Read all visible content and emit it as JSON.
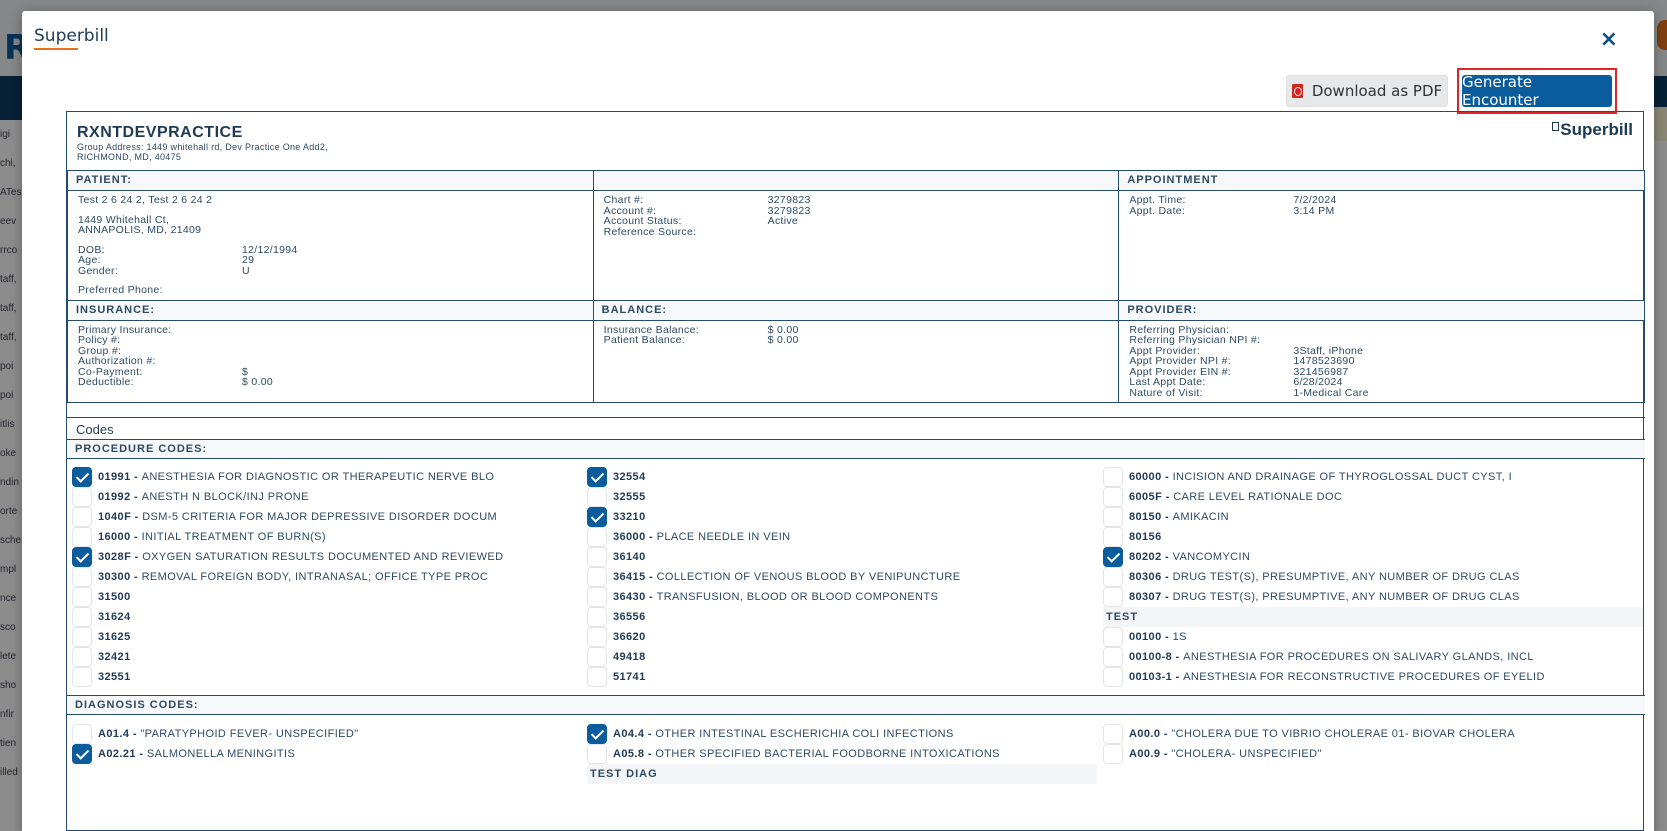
{
  "background": {
    "logo": "R",
    "sidebar_fragments": [
      "igi",
      "chi,",
      "ATes",
      "eev",
      "rrco",
      "taff,",
      "taff,",
      "taff,",
      "poi",
      "poi",
      "itlis",
      "oke",
      "ndin",
      "orte",
      "sche",
      "mpl",
      "nce",
      "sco",
      "lete",
      "sho",
      "nfir",
      "tien",
      "illed"
    ]
  },
  "modal": {
    "title": "Superbill",
    "close_icon": "×",
    "download_pdf_label": "Download as PDF",
    "generate_encounter_label": "Generate Encounter"
  },
  "sheet": {
    "practice_name": "RXNTDEVPRACTICE",
    "address_line1": "Group Address: 1449 whitehall rd, Dev Practice One Add2,",
    "address_line2": "RICHMOND, MD, 40475",
    "title": "Superbill"
  },
  "patient": {
    "header": "PATIENT:",
    "name": "Test 2 6 24 2, Test 2 6 24 2",
    "street": "1449 Whitehall Ct,",
    "city": "ANNAPOLIS, MD, 21409",
    "dob_label": "DOB:",
    "dob": "12/12/1994",
    "age_label": "Age:",
    "age": "29",
    "gender_label": "Gender:",
    "gender": "U",
    "phone_label": "Preferred Phone:"
  },
  "chart": {
    "chart_label": "Chart #:",
    "chart": "3279823",
    "account_label": "Account #:",
    "account": "3279823",
    "status_label": "Account Status:",
    "status": "Active",
    "ref_label": "Reference Source:"
  },
  "appointment": {
    "header": "APPOINTMENT",
    "time_label": "Appt. Time:",
    "time": "7/2/2024",
    "date_label": "Appt. Date:",
    "date": "3:14 PM"
  },
  "insurance": {
    "header": "INSURANCE:",
    "primary_label": "Primary Insurance:",
    "policy_label": "Policy #:",
    "group_label": "Group #:",
    "auth_label": "Authorization #:",
    "copay_label": "Co-Payment:",
    "copay": "$",
    "deductible_label": "Deductible:",
    "deductible": "$ 0.00"
  },
  "balance": {
    "header": "BALANCE:",
    "ins_label": "Insurance Balance:",
    "ins": "$ 0.00",
    "pat_label": "Patient Balance:",
    "pat": "$ 0.00"
  },
  "provider": {
    "header": "PROVIDER:",
    "ref_label": "Referring Physician:",
    "ref_npi_label": "Referring Physician NPI #:",
    "appt_prov_label": "Appt Provider:",
    "appt_prov": "3Staff, iPhone",
    "npi_label": "Appt Provider NPI #:",
    "npi": "1478523690",
    "ein_label": "Appt Provider EIN #:",
    "ein": "321456987",
    "last_label": "Last Appt Date:",
    "last": "6/28/2024",
    "nature_label": "Nature of Visit:",
    "nature": "1-Medical Care"
  },
  "codes": {
    "label": "Codes",
    "procedure_header": "PROCEDURE CODES:",
    "diagnosis_header": "DIAGNOSIS CODES:",
    "proc_col1": [
      {
        "code": "01991",
        "desc": "ANESTHESIA FOR DIAGNOSTIC OR THERAPEUTIC NERVE BLO",
        "checked": true
      },
      {
        "code": "01992",
        "desc": "ANESTH N BLOCK/INJ PRONE",
        "checked": false
      },
      {
        "code": "1040F",
        "desc": "DSM-5 CRITERIA FOR MAJOR DEPRESSIVE DISORDER DOCUM",
        "checked": false
      },
      {
        "code": "16000",
        "desc": "INITIAL TREATMENT OF BURN(S)",
        "checked": false
      },
      {
        "code": "3028F",
        "desc": "OXYGEN SATURATION RESULTS DOCUMENTED AND REVIEWED",
        "checked": true
      },
      {
        "code": "30300",
        "desc": "REMOVAL FOREIGN BODY, INTRANASAL; OFFICE TYPE PROC",
        "checked": false
      },
      {
        "code": "31500",
        "desc": "",
        "checked": false
      },
      {
        "code": "31624",
        "desc": "",
        "checked": false
      },
      {
        "code": "31625",
        "desc": "",
        "checked": false
      },
      {
        "code": "32421",
        "desc": "",
        "checked": false
      },
      {
        "code": "32551",
        "desc": "",
        "checked": false
      }
    ],
    "proc_col2": [
      {
        "code": "32554",
        "desc": "",
        "checked": true
      },
      {
        "code": "32555",
        "desc": "",
        "checked": false
      },
      {
        "code": "33210",
        "desc": "",
        "checked": true
      },
      {
        "code": "36000",
        "desc": "PLACE NEEDLE IN VEIN",
        "checked": false
      },
      {
        "code": "36140",
        "desc": "",
        "checked": false
      },
      {
        "code": "36415",
        "desc": "COLLECTION OF VENOUS BLOOD BY VENIPUNCTURE",
        "checked": false
      },
      {
        "code": "36430",
        "desc": "TRANSFUSION, BLOOD OR BLOOD COMPONENTS",
        "checked": false
      },
      {
        "code": "36556",
        "desc": "",
        "checked": false
      },
      {
        "code": "36620",
        "desc": "",
        "checked": false
      },
      {
        "code": "49418",
        "desc": "",
        "checked": false
      },
      {
        "code": "51741",
        "desc": "",
        "checked": false
      }
    ],
    "proc_col3_a": [
      {
        "code": "60000",
        "desc": "INCISION AND DRAINAGE OF THYROGLOSSAL DUCT CYST, I",
        "checked": false
      },
      {
        "code": "6005F",
        "desc": "CARE LEVEL RATIONALE DOC",
        "checked": false
      },
      {
        "code": "80150",
        "desc": "AMIKACIN",
        "checked": false
      },
      {
        "code": "80156",
        "desc": "",
        "checked": false
      },
      {
        "code": "80202",
        "desc": "VANCOMYCIN",
        "checked": true
      },
      {
        "code": "80306",
        "desc": "DRUG TEST(S), PRESUMPTIVE, ANY NUMBER OF DRUG CLAS",
        "checked": false
      },
      {
        "code": "80307",
        "desc": "DRUG TEST(S), PRESUMPTIVE, ANY NUMBER OF DRUG CLAS",
        "checked": false
      }
    ],
    "proc_group_label": "TEST",
    "proc_col3_b": [
      {
        "code": "00100",
        "desc": "1S",
        "checked": false
      },
      {
        "code": "00100-8",
        "desc": "ANESTHESIA FOR PROCEDURES ON SALIVARY GLANDS, INCL",
        "checked": false
      },
      {
        "code": "00103-1",
        "desc": "ANESTHESIA FOR RECONSTRUCTIVE PROCEDURES OF EYELID",
        "checked": false
      }
    ],
    "diag_col1": [
      {
        "code": "A01.4",
        "desc": "\"PARATYPHOID FEVER- UNSPECIFIED\"",
        "checked": false
      },
      {
        "code": "A02.21",
        "desc": "SALMONELLA MENINGITIS",
        "checked": true
      }
    ],
    "diag_col2": [
      {
        "code": "A04.4",
        "desc": "OTHER INTESTINAL ESCHERICHIA COLI INFECTIONS",
        "checked": true
      },
      {
        "code": "A05.8",
        "desc": "OTHER SPECIFIED BACTERIAL FOODBORNE INTOXICATIONS",
        "checked": false
      }
    ],
    "diag_group_label": "TEST DIAG",
    "diag_col3": [
      {
        "code": "A00.0",
        "desc": "\"CHOLERA DUE TO VIBRIO CHOLERAE 01- BIOVAR CHOLERA",
        "checked": false
      },
      {
        "code": "A00.9",
        "desc": "\"CHOLERA- UNSPECIFIED\"",
        "checked": false
      }
    ]
  }
}
